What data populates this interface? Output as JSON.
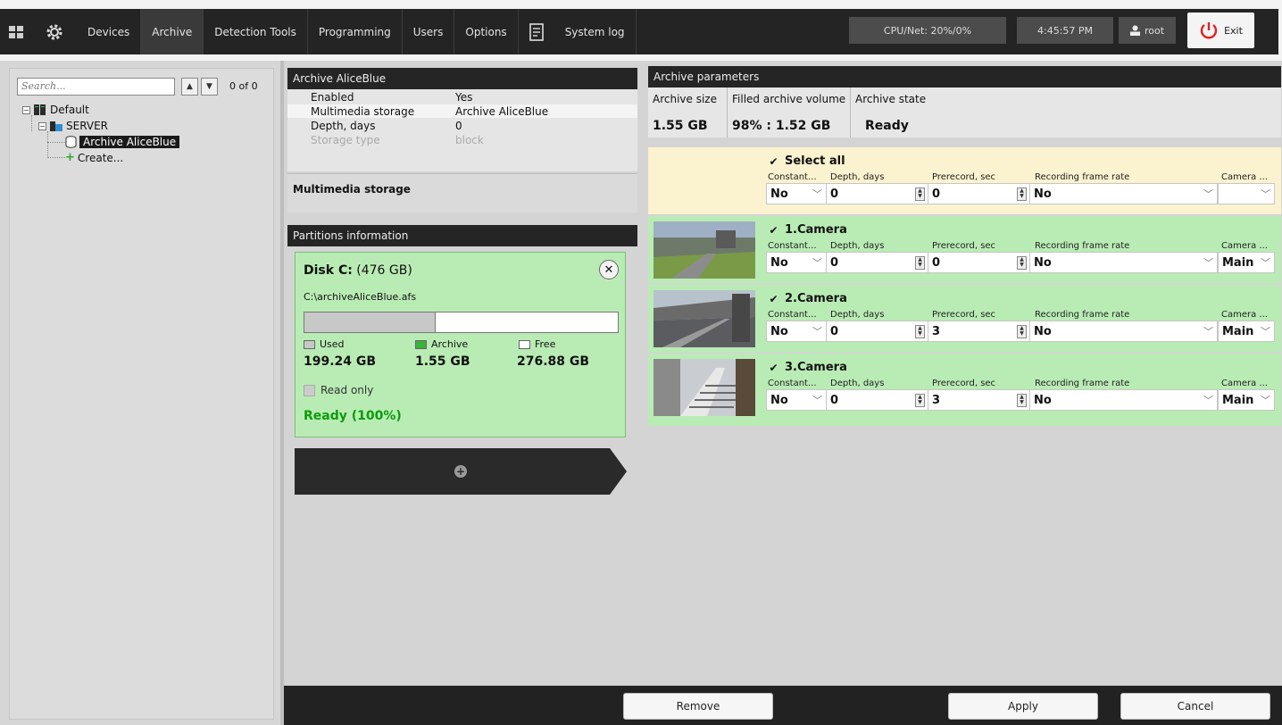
{
  "topbar": {
    "menu": [
      "Devices",
      "Archive",
      "Detection Tools",
      "Programming",
      "Users",
      "Options"
    ],
    "active_menu": "Archive",
    "system_log": "System log",
    "cpu": "CPU/Net: 20%/0%",
    "clock": "4:45:57 PM",
    "user": "root",
    "exit": "Exit",
    "colors": {
      "bar": "#242424",
      "exit_icon": "#e02020"
    }
  },
  "tree": {
    "search_placeholder": "Search...",
    "counter": "0 of 0",
    "default": "Default",
    "server": "SERVER",
    "archive": "Archive AliceBlue",
    "create": "Create..."
  },
  "archive_panel": {
    "title": "Archive AliceBlue",
    "props": [
      {
        "key": "Enabled",
        "value": "Yes"
      },
      {
        "key": "Multimedia storage",
        "value": "Archive AliceBlue"
      },
      {
        "key": "Depth, days",
        "value": "0"
      },
      {
        "key": "Storage type",
        "value": "block"
      }
    ],
    "multimedia_storage_label": "Multimedia storage"
  },
  "partitions": {
    "title": "Partitions information",
    "disk_name": "Disk C:",
    "disk_size": "(476 GB)",
    "path": "C:\\archiveAliceBlue.afs",
    "used_fraction": 0.42,
    "legend": {
      "used": "Used",
      "archive": "Archive",
      "free": "Free"
    },
    "used": "199.24 GB",
    "archive": "1.55 GB",
    "free": "276.88 GB",
    "read_only": "Read only",
    "status": "Ready (100%)"
  },
  "archive_params": {
    "title": "Archive parameters",
    "headers": [
      "Archive size",
      "Filled archive volume",
      "Archive state"
    ],
    "values": [
      "1.55 GB",
      "98% : 1.52 GB",
      "Ready"
    ]
  },
  "field_labels": {
    "constant": "Constant...",
    "depth": "Depth, days",
    "prerecord": "Prerecord, sec",
    "fps": "Recording frame rate",
    "camera": "Camera ..."
  },
  "rows": [
    {
      "name": "Select all",
      "constant": "No",
      "depth": "0",
      "prerecord": "0",
      "fps": "No",
      "stream": ""
    },
    {
      "name": "1.Camera",
      "constant": "No",
      "depth": "0",
      "prerecord": "0",
      "fps": "No",
      "stream": "Main"
    },
    {
      "name": "2.Camera",
      "constant": "No",
      "depth": "0",
      "prerecord": "3",
      "fps": "No",
      "stream": "Main"
    },
    {
      "name": "3.Camera",
      "constant": "No",
      "depth": "0",
      "prerecord": "3",
      "fps": "No",
      "stream": "Main"
    }
  ],
  "footer": {
    "remove": "Remove",
    "apply": "Apply",
    "cancel": "Cancel"
  }
}
